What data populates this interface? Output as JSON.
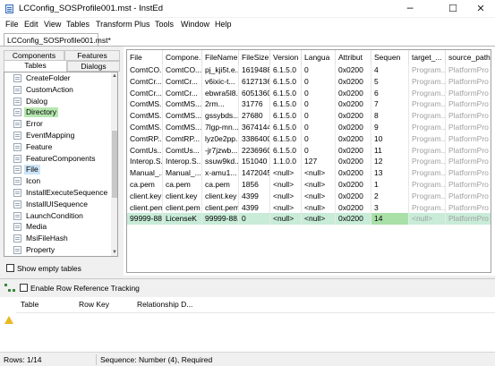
{
  "window": {
    "title": "LCConfig_SOSProfile001.mst - InstEd",
    "controls": {
      "minimize": "─",
      "maximize": "☐",
      "close": "✕"
    }
  },
  "menu": [
    "File",
    "Edit",
    "View",
    "Tables",
    "Transform",
    "Plus",
    "Tools",
    "Window",
    "Help"
  ],
  "doc_tab": "LCConfig_SOSProfile001.mst*",
  "left_tabs": {
    "components": "Components",
    "features": "Features",
    "tables": "Tables",
    "dialogs": "Dialogs"
  },
  "tables_list": [
    {
      "name": "CreateFolder",
      "state": "normal"
    },
    {
      "name": "CustomAction",
      "state": "normal"
    },
    {
      "name": "Dialog",
      "state": "normal"
    },
    {
      "name": "Directory",
      "state": "modified"
    },
    {
      "name": "Error",
      "state": "normal"
    },
    {
      "name": "EventMapping",
      "state": "normal"
    },
    {
      "name": "Feature",
      "state": "normal"
    },
    {
      "name": "FeatureComponents",
      "state": "normal"
    },
    {
      "name": "File",
      "state": "selected"
    },
    {
      "name": "Icon",
      "state": "normal"
    },
    {
      "name": "InstallExecuteSequence",
      "state": "normal"
    },
    {
      "name": "InstallUISequence",
      "state": "normal"
    },
    {
      "name": "LaunchCondition",
      "state": "normal"
    },
    {
      "name": "Media",
      "state": "normal"
    },
    {
      "name": "MsiFileHash",
      "state": "normal"
    },
    {
      "name": "Property",
      "state": "normal"
    }
  ],
  "show_empty_tables": {
    "label": "Show empty tables",
    "checked": false
  },
  "grid": {
    "columns": [
      "File",
      "Compone...",
      "FileName",
      "FileSize",
      "Version",
      "Langua",
      "Attribut",
      "Sequen",
      "target_...",
      "source_path"
    ],
    "rows": [
      [
        "ComtCO...",
        "ComtCO...",
        "pj_kji5t.e...",
        "1619488",
        "6.1.5.0",
        "0",
        "0x0200",
        "4",
        "Program...",
        "PlatformPro"
      ],
      [
        "ComtCr...",
        "ComtCr...",
        "v6ixic-t...",
        "6127136",
        "6.1.5.0",
        "0",
        "0x0200",
        "5",
        "Program...",
        "PlatformPro"
      ],
      [
        "ComtCr...",
        "ComtCr...",
        "ebwra5l8...",
        "6051360",
        "6.1.5.0",
        "0",
        "0x0200",
        "6",
        "Program...",
        "PlatformPro"
      ],
      [
        "ComtMS...",
        "ComtMS...",
        "2rm...",
        "31776",
        "6.1.5.0",
        "0",
        "0x0200",
        "7",
        "Program...",
        "PlatformPro"
      ],
      [
        "ComtMS...",
        "ComtMS...",
        "gssybds...",
        "27680",
        "6.1.5.0",
        "0",
        "0x0200",
        "8",
        "Program...",
        "PlatformPro"
      ],
      [
        "ComtMS...",
        "ComtMS...",
        "7lgp-mn...",
        "3674144",
        "6.1.5.0",
        "0",
        "0x0200",
        "9",
        "Program...",
        "PlatformPro"
      ],
      [
        "ComtRP...",
        "ComtRP...",
        "lyz0e2pp...",
        "3386400",
        "6.1.5.0",
        "0",
        "0x0200",
        "10",
        "Program...",
        "PlatformPro"
      ],
      [
        "ComtUs...",
        "ComtUs...",
        "-jr7jzwb...",
        "2236960",
        "6.1.5.0",
        "0",
        "0x0200",
        "11",
        "Program...",
        "PlatformPro"
      ],
      [
        "Interop.S...",
        "Interop.S...",
        "ssuw9kd...",
        "151040",
        "1.1.0.0",
        "127",
        "0x0200",
        "12",
        "Program...",
        "PlatformPro"
      ],
      [
        "Manual_...",
        "Manual_...",
        "x-amu1...",
        "1472045",
        "<null>",
        "<null>",
        "0x0200",
        "13",
        "Program...",
        "PlatformPro"
      ],
      [
        "ca.pem",
        "ca.pem",
        "ca.pem",
        "1856",
        "<null>",
        "<null>",
        "0x0200",
        "1",
        "Program...",
        "PlatformPro"
      ],
      [
        "client.key",
        "client.key",
        "client.key",
        "4399",
        "<null>",
        "<null>",
        "0x0200",
        "2",
        "Program...",
        "PlatformPro"
      ],
      [
        "client.pem",
        "client.pem",
        "client.pem",
        "4399",
        "<null>",
        "<null>",
        "0x0200",
        "3",
        "Program...",
        "PlatformPro"
      ],
      [
        "99999-88...",
        "LicenseK",
        "99999-88...",
        "0",
        "<null>",
        "<null>",
        "0x0200",
        "14",
        "<null>",
        "PlatformPro"
      ]
    ]
  },
  "row_ref": {
    "label": "Enable Row Reference Tracking",
    "checked": false
  },
  "relationship_columns": [
    "Table",
    "Row Key",
    "Relationship D..."
  ],
  "status": {
    "rows": "Rows: 1/14",
    "info": "Sequence: Number (4), Required"
  },
  "colors": {
    "modified_table": "#b6e7b0",
    "selected_table": "#cce4f7",
    "selected_row": "#c8ecd8",
    "selected_cell": "#a8e0a8",
    "grey_text": "#a0a0a0"
  }
}
